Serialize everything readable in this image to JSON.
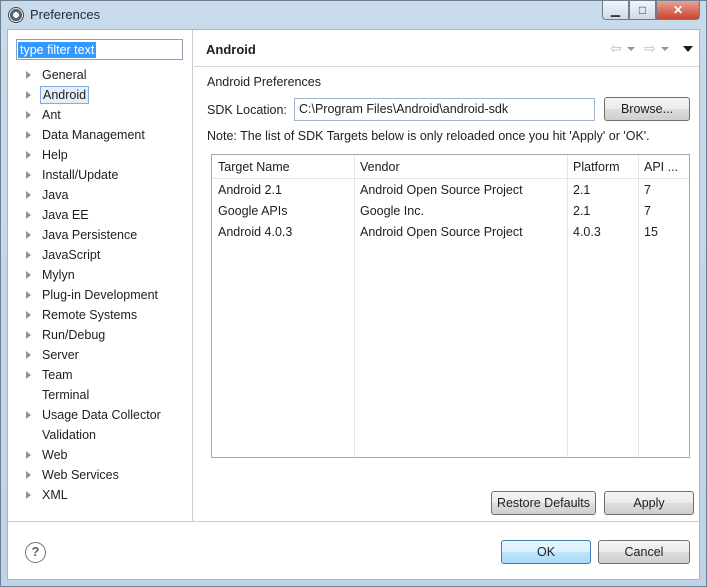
{
  "window": {
    "title": "Preferences",
    "controls": {
      "minimize": "▁",
      "maximize": "□",
      "close": "✕"
    }
  },
  "filter": {
    "value": "type filter text"
  },
  "tree": {
    "items": [
      {
        "label": "General",
        "expandable": true,
        "selected": false
      },
      {
        "label": "Android",
        "expandable": true,
        "selected": true
      },
      {
        "label": "Ant",
        "expandable": true,
        "selected": false
      },
      {
        "label": "Data Management",
        "expandable": true,
        "selected": false
      },
      {
        "label": "Help",
        "expandable": true,
        "selected": false
      },
      {
        "label": "Install/Update",
        "expandable": true,
        "selected": false
      },
      {
        "label": "Java",
        "expandable": true,
        "selected": false
      },
      {
        "label": "Java EE",
        "expandable": true,
        "selected": false
      },
      {
        "label": "Java Persistence",
        "expandable": true,
        "selected": false
      },
      {
        "label": "JavaScript",
        "expandable": true,
        "selected": false
      },
      {
        "label": "Mylyn",
        "expandable": true,
        "selected": false
      },
      {
        "label": "Plug-in Development",
        "expandable": true,
        "selected": false
      },
      {
        "label": "Remote Systems",
        "expandable": true,
        "selected": false
      },
      {
        "label": "Run/Debug",
        "expandable": true,
        "selected": false
      },
      {
        "label": "Server",
        "expandable": true,
        "selected": false
      },
      {
        "label": "Team",
        "expandable": true,
        "selected": false
      },
      {
        "label": "Terminal",
        "expandable": false,
        "selected": false
      },
      {
        "label": "Usage Data Collector",
        "expandable": true,
        "selected": false
      },
      {
        "label": "Validation",
        "expandable": false,
        "selected": false
      },
      {
        "label": "Web",
        "expandable": true,
        "selected": false
      },
      {
        "label": "Web Services",
        "expandable": true,
        "selected": false
      },
      {
        "label": "XML",
        "expandable": true,
        "selected": false
      }
    ]
  },
  "page": {
    "title": "Android",
    "nav": {
      "back": "⇦",
      "forward": "⇨"
    },
    "section_label": "Android Preferences",
    "sdk_label": "SDK Location:",
    "sdk_value": "C:\\Program Files\\Android\\android-sdk",
    "browse_label": "Browse...",
    "note": "Note: The list of SDK Targets below is only reloaded once you hit 'Apply' or 'OK'.",
    "table": {
      "columns": [
        "Target Name",
        "Vendor",
        "Platform",
        "API ..."
      ],
      "rows": [
        [
          "Android 2.1",
          "Android Open Source Project",
          "2.1",
          "7"
        ],
        [
          "Google APIs",
          "Google Inc.",
          "2.1",
          "7"
        ],
        [
          "Android 4.0.3",
          "Android Open Source Project",
          "4.0.3",
          "15"
        ]
      ]
    },
    "restore_defaults_label": "Restore Defaults",
    "apply_label": "Apply"
  },
  "footer": {
    "help": "?",
    "ok_label": "OK",
    "cancel_label": "Cancel"
  },
  "colors": {
    "selection_bg": "#e4effb",
    "selection_border": "#84acdd",
    "filter_highlight": "#3399ff",
    "default_button_border": "#3c7fb1"
  }
}
